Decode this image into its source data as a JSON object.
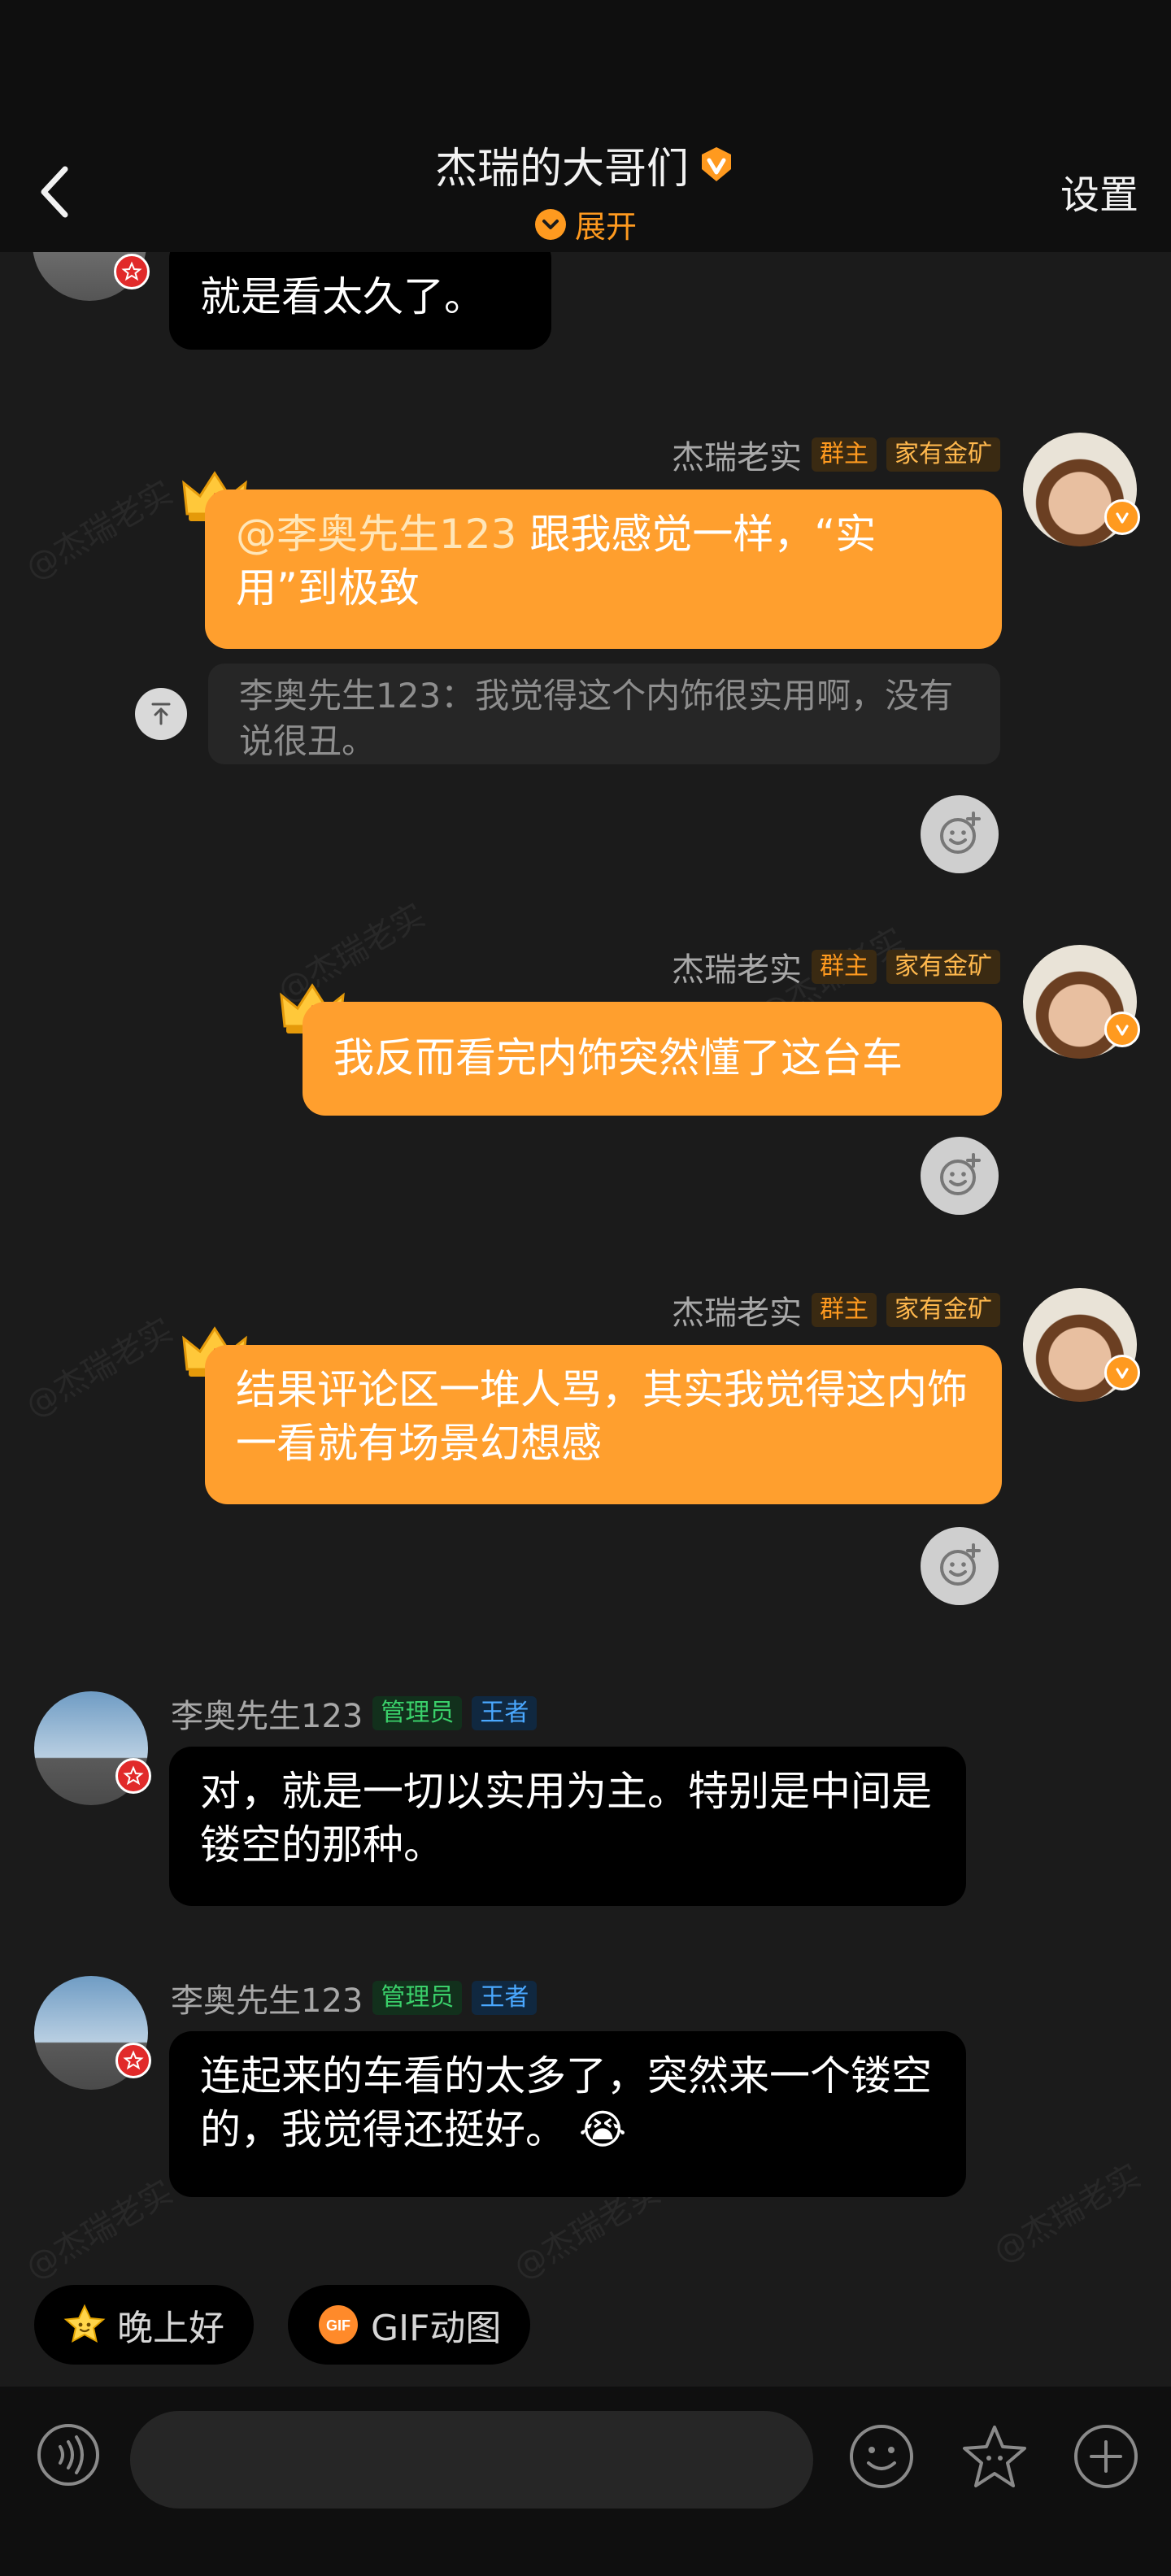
{
  "header": {
    "title": "杰瑞的大哥们",
    "expand_label": "展开",
    "settings_label": "设置"
  },
  "messages": [
    {
      "id": "m0",
      "side": "left",
      "text": "就是看太久了。"
    },
    {
      "id": "m1",
      "side": "right",
      "sender": "杰瑞老实",
      "tags": [
        "群主",
        "家有金矿"
      ],
      "mention": "@李奥先生123",
      "text_after_mention": "跟我感觉一样，“实用”到极致",
      "quote": "李奥先生123：我觉得这个内饰很实用啊，没有说很丑。"
    },
    {
      "id": "m2",
      "side": "right",
      "sender": "杰瑞老实",
      "tags": [
        "群主",
        "家有金矿"
      ],
      "text": "我反而看完内饰突然懂了这台车"
    },
    {
      "id": "m3",
      "side": "right",
      "sender": "杰瑞老实",
      "tags": [
        "群主",
        "家有金矿"
      ],
      "text": "结果评论区一堆人骂，其实我觉得这内饰一看就有场景幻想感"
    },
    {
      "id": "m4",
      "side": "left",
      "sender": "李奥先生123",
      "tags": [
        "管理员",
        "王者"
      ],
      "text": "对，就是一切以实用为主。特别是中间是镂空的那种。"
    },
    {
      "id": "m5",
      "side": "left",
      "sender": "李奥先生123",
      "tags": [
        "管理员",
        "王者"
      ],
      "text": "连起来的车看的太多了，突然来一个镂空的，我觉得还挺好。"
    }
  ],
  "emoji": {
    "m5_trailing": "😭"
  },
  "quick_replies": [
    {
      "icon": "star-face-icon",
      "label": "晚上好"
    },
    {
      "icon": "gif-icon",
      "label": "GIF动图"
    }
  ],
  "watermark": "@杰瑞老实",
  "colors": {
    "accent": "#ff9f2e",
    "background": "#1b1b1b",
    "bubble_dark": "#000000"
  }
}
